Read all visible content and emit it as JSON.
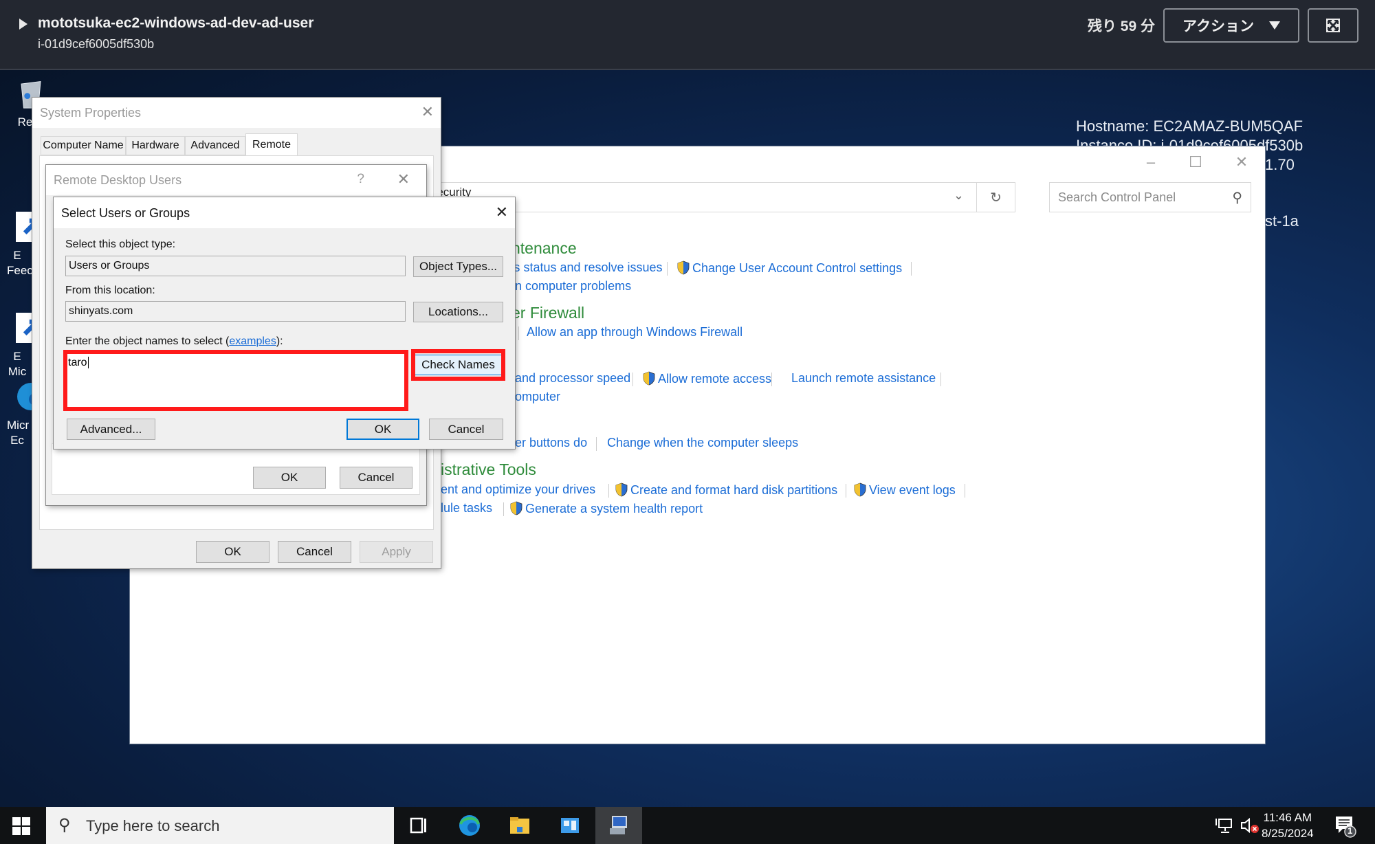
{
  "session_header": {
    "instance_name": "mototsuka-ec2-windows-ad-dev-ad-user",
    "instance_id": "i-01d9cef6005df530b",
    "time_remaining": "残り 59 分",
    "actions_label": "アクション",
    "fullscreen_icon": "expand-icon"
  },
  "desktop": {
    "host_info": {
      "hostname": "Hostname: EC2AMAZ-BUM5QAF",
      "instance_id": "Instance ID: i-01d9cef6005df530b",
      "ip_partial": "1.70",
      "az_partial": "st-1a"
    },
    "icons": [
      {
        "label": "Recy",
        "icon": "recycle-bin-icon"
      },
      {
        "label": "E Feec",
        "icon": "shortcut-icon"
      },
      {
        "label": "E Mic",
        "icon": "shortcut-icon"
      },
      {
        "label": "Micr Ec",
        "icon": "edge-icon"
      }
    ]
  },
  "control_panel": {
    "address_partial": "Security",
    "search_placeholder": "Search Control Panel",
    "sections": [
      {
        "title": "ntenance",
        "links": [
          "'s status and resolve issues",
          "Change User Account Control settings",
          "n computer problems"
        ]
      },
      {
        "title": "er Firewall",
        "links": [
          "Allow an app through Windows Firewall"
        ]
      },
      {
        "title": "",
        "links": [
          "and processor speed",
          "Allow remote access",
          "Launch remote assistance",
          "omputer"
        ]
      },
      {
        "title": "",
        "links": [
          "er buttons do",
          "Change when the computer sleeps"
        ]
      },
      {
        "title": "istrative Tools",
        "links": [
          "ent and optimize your drives",
          "Create and format hard disk partitions",
          "View event logs",
          "lule tasks",
          "Generate a system health report"
        ]
      }
    ]
  },
  "system_properties": {
    "title": "System Properties",
    "tabs": [
      "Computer Name",
      "Hardware",
      "Advanced",
      "Remote"
    ],
    "active_tab": "Remote",
    "buttons": {
      "ok": "OK",
      "cancel": "Cancel",
      "apply": "Apply"
    }
  },
  "remote_desktop_users": {
    "title": "Remote Desktop Users",
    "help": "?",
    "buttons": {
      "ok": "OK",
      "cancel": "Cancel"
    }
  },
  "select_users": {
    "title": "Select Users or Groups",
    "object_type_label": "Select this object type:",
    "object_type_value": "Users or Groups",
    "object_types_button": "Object Types...",
    "location_label": "From this location:",
    "location_value": "shinyats.com",
    "locations_button": "Locations...",
    "names_label_prefix": "Enter the object names to select (",
    "names_label_link": "examples",
    "names_label_suffix": "):",
    "names_value": "taro",
    "check_names_button": "Check Names",
    "advanced_button": "Advanced...",
    "ok_button": "OK",
    "cancel_button": "Cancel",
    "highlight_color": "#ff1a1a"
  },
  "taskbar": {
    "search_placeholder": "Type here to search",
    "apps": [
      "task-view-icon",
      "edge-icon",
      "file-explorer-icon",
      "server-manager-icon",
      "system-properties-icon"
    ],
    "time": "11:46 AM",
    "date": "8/25/2024",
    "notification_count": "1"
  }
}
